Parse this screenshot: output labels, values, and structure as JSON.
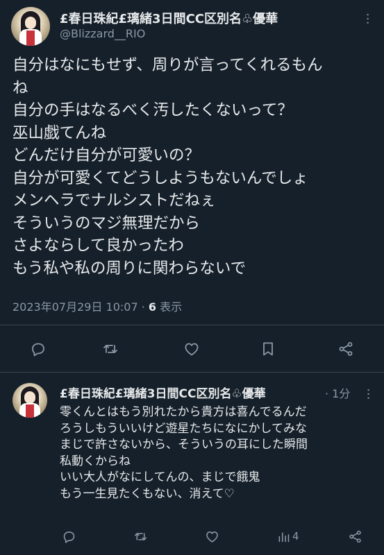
{
  "tweet": {
    "display_name": "£春日珠紀£璃緒3日間CC区別名♧優華",
    "handle": "@Blizzard__RIO",
    "more": "···",
    "lines": [
      "自分はなにもせず、周りが言ってくれるもん",
      "ね",
      "自分の手はなるべく汚したくないって？",
      "巫山戯てんね",
      "どんだけ自分が可愛いの？",
      "自分が可愛くてどうしようもないんでしょ",
      "メンヘラでナルシストだねぇ",
      "そういうのマジ無理だから",
      "さよならして良かったわ",
      "もう私や私の周りに関わらないで"
    ],
    "timestamp": "2023年07月29日 10:07",
    "dot": " · ",
    "views_count": "6",
    "views_label": " 表示"
  },
  "reply": {
    "display_name": "£春日珠紀£璃緒3日間CC区別名♧優華",
    "time": "· 1分",
    "lines": [
      "零くんとはもう別れたから貴方は喜んでるんだ",
      "ろうしもういいけど遊星たちになにかしてみな",
      "まじで許さないから、そういうの耳にした瞬間",
      "私動くからね",
      "いい大人がなにしてんの、まじで餓鬼",
      "もう一生見たくもない、消えて♡"
    ],
    "views": "4"
  },
  "icons": {
    "reply": "reply-icon",
    "retweet": "retweet-icon",
    "like": "like-icon",
    "bookmark": "bookmark-icon",
    "share": "share-icon",
    "views": "views-icon"
  },
  "colors": {
    "background": "#15202b",
    "text": "#e7e9ea",
    "muted": "#8b98a5",
    "divider": "#38444d"
  }
}
